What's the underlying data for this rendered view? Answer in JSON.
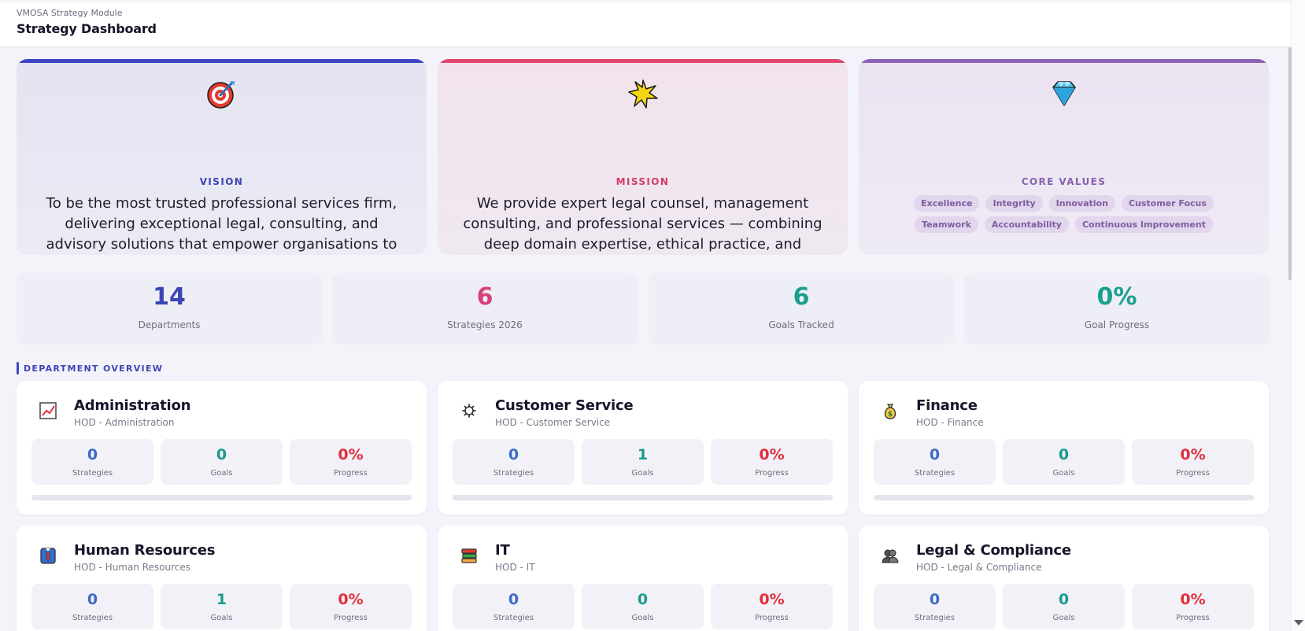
{
  "header": {
    "module": "VMOSA Strategy Module",
    "title": "Strategy Dashboard"
  },
  "vision": {
    "icon": "target-icon",
    "label": "VISION",
    "text": "To be the most trusted professional services firm, delivering exceptional legal, consulting, and advisory solutions that empower organisations to navigate complexity and achieve their strategic goals.",
    "color": "#3d47c3"
  },
  "mission": {
    "icon": "star-burst-icon",
    "label": "MISSION",
    "text": "We provide expert legal counsel, management consulting, and professional services — combining deep domain expertise, ethical practice, and technology-enabled delivery to solve our clients most challenging problems.",
    "color": "#e0476f"
  },
  "values": {
    "icon": "diamond-icon",
    "label": "CORE VALUES",
    "items": [
      "Excellence",
      "Integrity",
      "Innovation",
      "Customer Focus",
      "Teamwork",
      "Accountability",
      "Continuous Improvement"
    ],
    "color": "#8e63b5"
  },
  "stats": [
    {
      "value": "14",
      "label": "Departments",
      "color": "#3a44b5"
    },
    {
      "value": "6",
      "label": "Strategies 2026",
      "color": "#d6427a"
    },
    {
      "value": "6",
      "label": "Goals Tracked",
      "color": "#19a08d"
    },
    {
      "value": "0%",
      "label": "Goal Progress",
      "color": "#19a08d"
    }
  ],
  "section": {
    "title": "DEPARTMENT OVERVIEW"
  },
  "departments": [
    {
      "name": "Administration",
      "hod": "HOD - Administration",
      "icon": "chart-increasing-icon",
      "strategies": "0",
      "goals": "0",
      "progress": "0%",
      "progress_fraction": 0,
      "labels": [
        "Strategies",
        "Goals",
        "Progress"
      ]
    },
    {
      "name": "Customer Service",
      "hod": "HOD - Customer Service",
      "icon": "gear-icon",
      "strategies": "0",
      "goals": "1",
      "progress": "0%",
      "progress_fraction": 0,
      "labels": [
        "Strategies",
        "Goals",
        "Progress"
      ]
    },
    {
      "name": "Finance",
      "hod": "HOD - Finance",
      "icon": "money-bag-icon",
      "strategies": "0",
      "goals": "0",
      "progress": "0%",
      "progress_fraction": 0,
      "labels": [
        "Strategies",
        "Goals",
        "Progress"
      ]
    },
    {
      "name": "Human Resources",
      "hod": "HOD - Human Resources",
      "icon": "person-tie-icon",
      "strategies": "0",
      "goals": "1",
      "progress": "0%",
      "progress_fraction": 0,
      "labels": [
        "Strategies",
        "Goals",
        "Progress"
      ]
    },
    {
      "name": "IT",
      "hod": "HOD - IT",
      "icon": "books-stack-icon",
      "strategies": "0",
      "goals": "0",
      "progress": "0%",
      "progress_fraction": 0,
      "labels": [
        "Strategies",
        "Goals",
        "Progress"
      ]
    },
    {
      "name": "Legal & Compliance",
      "hod": "HOD - Legal & Compliance",
      "icon": "people-silhouette-icon",
      "strategies": "0",
      "goals": "0",
      "progress": "0%",
      "progress_fraction": 0,
      "labels": [
        "Strategies",
        "Goals",
        "Progress"
      ]
    }
  ]
}
